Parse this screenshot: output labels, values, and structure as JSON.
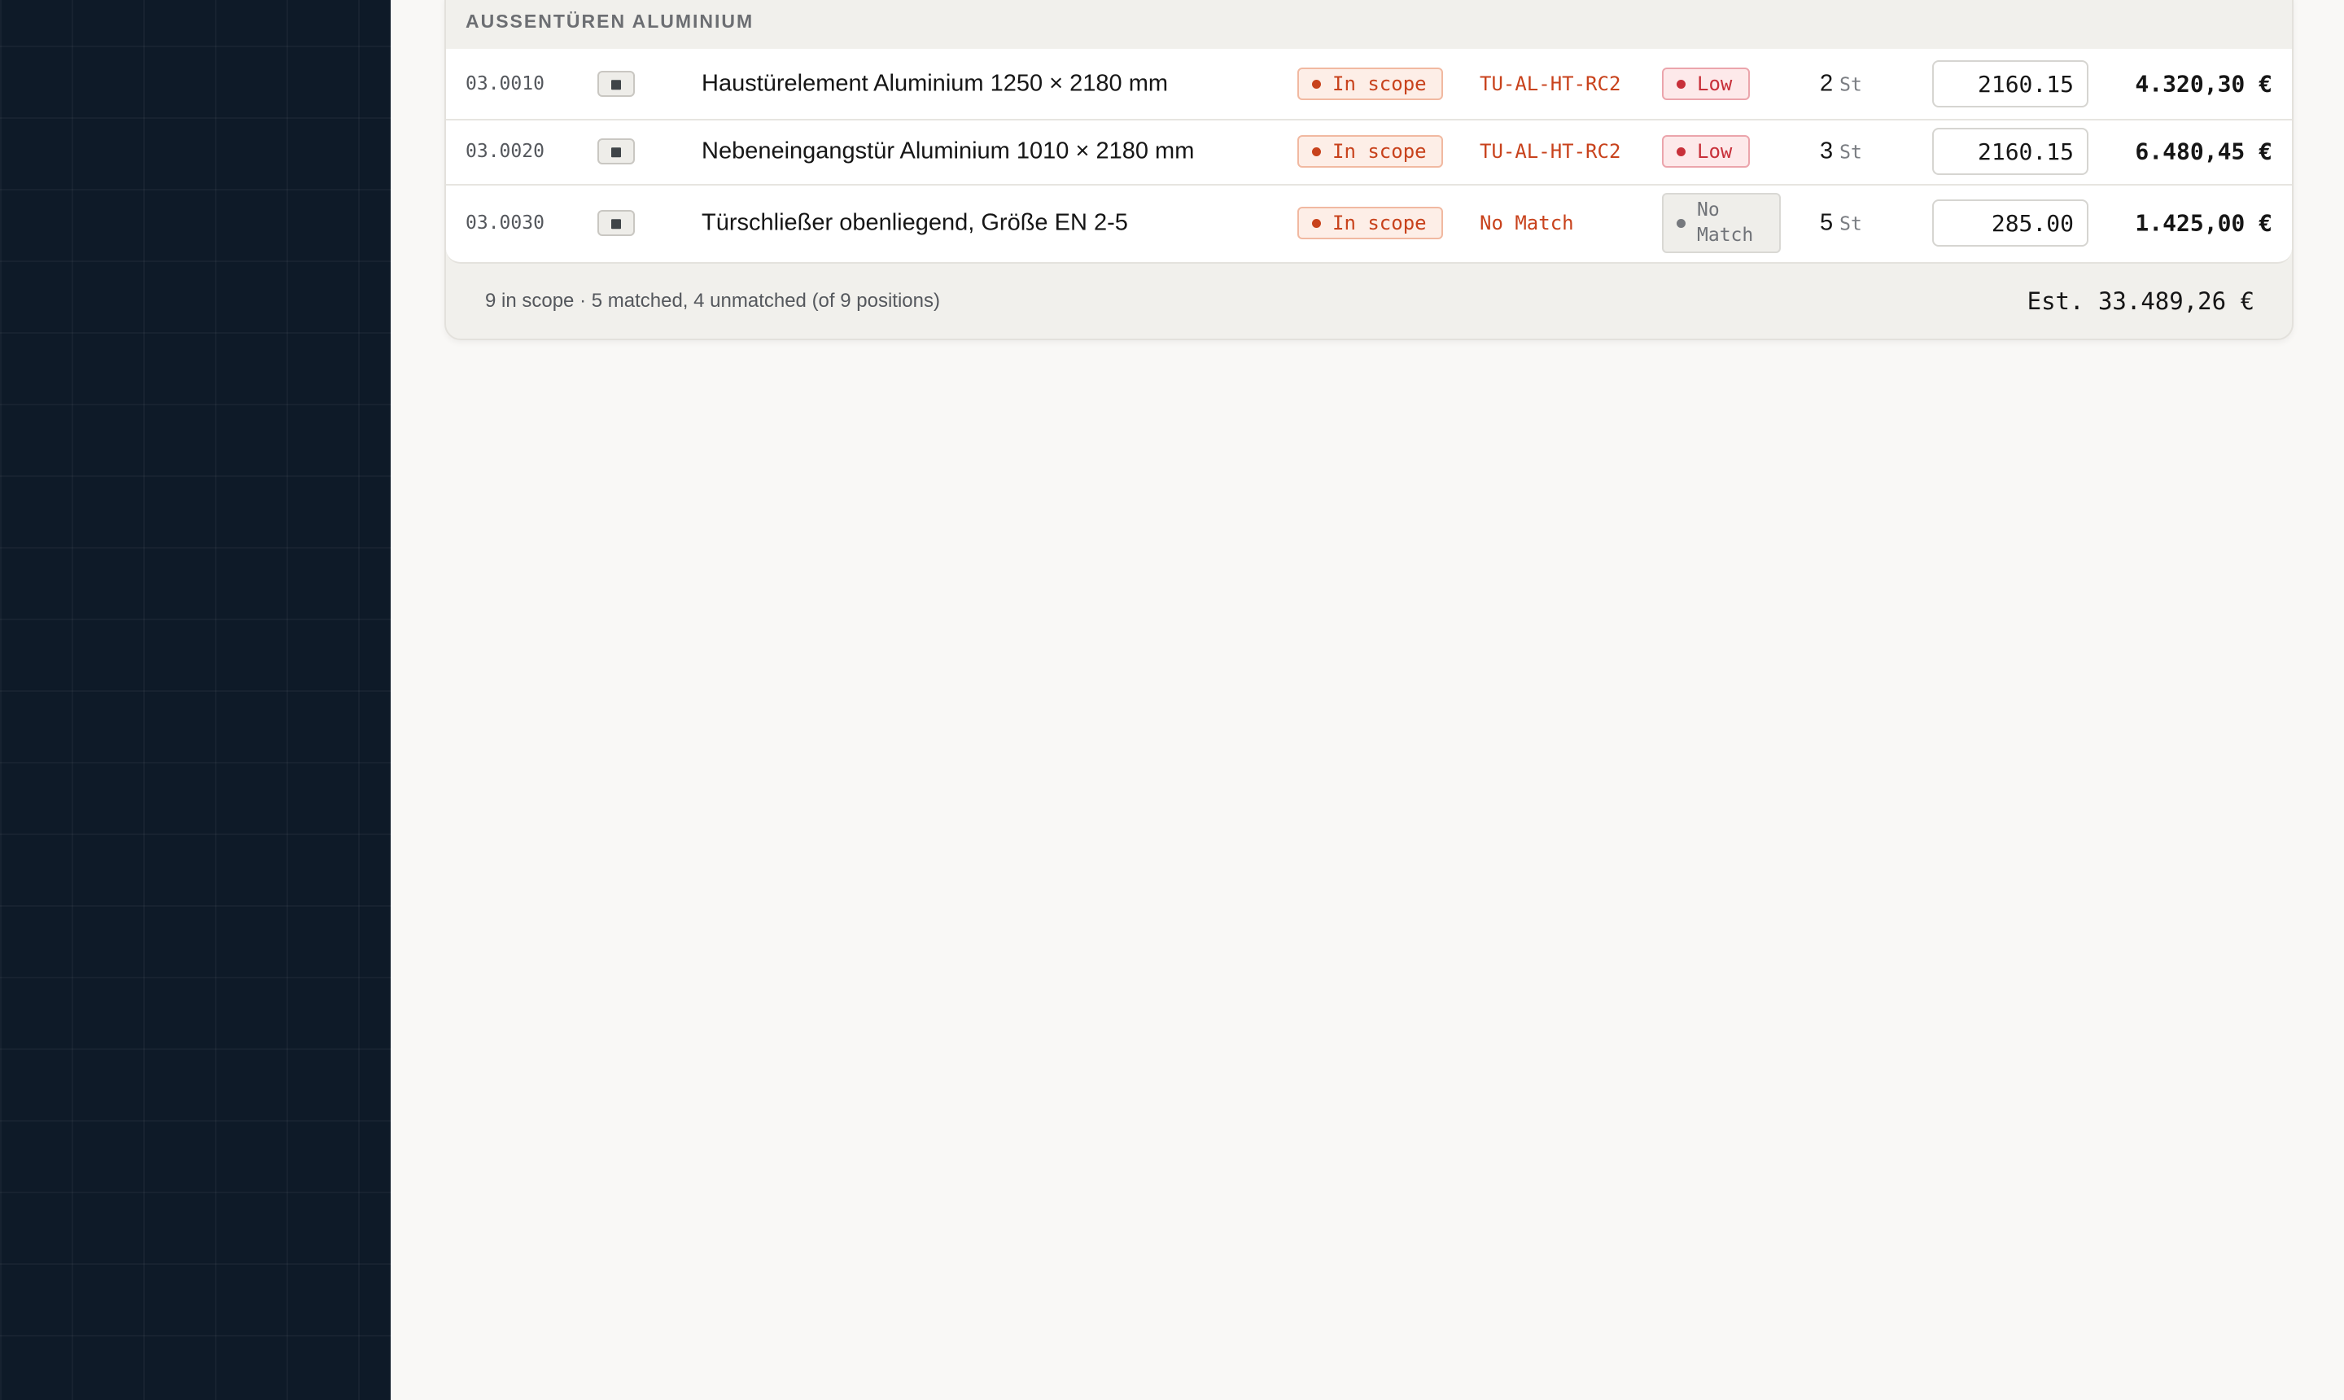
{
  "section": {
    "title": "AUSSENTÜREN ALUMINIUM"
  },
  "rows": [
    {
      "position": "03.0010",
      "description": "Haustürelement Aluminium 1250 × 2180 mm",
      "scope": "In scope",
      "match_code": "TU-AL-HT-RC2",
      "confidence": "Low",
      "quantity": "2",
      "unit": "St",
      "unit_price": "2160.15",
      "total": "4.320,30 €"
    },
    {
      "position": "03.0020",
      "description": "Nebeneingangstür Aluminium 1010 × 2180 mm",
      "scope": "In scope",
      "match_code": "TU-AL-HT-RC2",
      "confidence": "Low",
      "quantity": "3",
      "unit": "St",
      "unit_price": "2160.15",
      "total": "6.480,45 €"
    },
    {
      "position": "03.0030",
      "description": "Türschließer obenliegend, Größe EN 2-5",
      "scope": "In scope",
      "match_code": "No Match",
      "confidence": "No Match",
      "quantity": "5",
      "unit": "St",
      "unit_price": "285.00",
      "total": "1.425,00 €"
    }
  ],
  "footer": {
    "summary": "9 in scope · 5 matched, 4 unmatched (of 9 positions)",
    "estimate": "Est. 33.489,26 €"
  },
  "colors": {
    "sidebar": "#0e1a28",
    "scope_accent": "#c8421c",
    "low_accent": "#c8303a",
    "neutral_badge": "#707378"
  },
  "icons": {
    "row_toggle": "square-toggle-icon",
    "status_dot": "dot-icon"
  }
}
